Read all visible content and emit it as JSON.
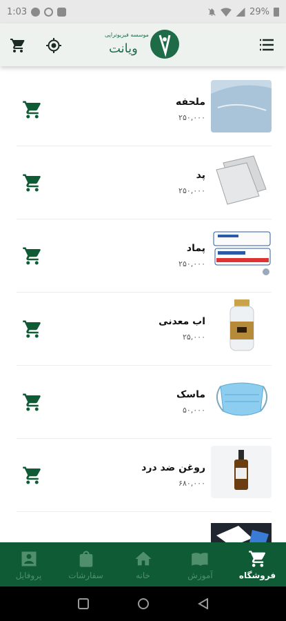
{
  "status": {
    "time": "1:03",
    "battery": "29%"
  },
  "header": {
    "logo_line1": "موسسه فیزیوتراپی",
    "logo_line2": "ویانت"
  },
  "products": [
    {
      "name": "ملحفه",
      "price": "۲۵۰,۰۰۰",
      "img": "sheet"
    },
    {
      "name": "پد",
      "price": "۲۵۰,۰۰۰",
      "img": "pad"
    },
    {
      "name": "پماد",
      "price": "۲۵۰,۰۰۰",
      "img": "ointment"
    },
    {
      "name": "اب معدنی",
      "price": "۲۵,۰۰۰",
      "img": "water"
    },
    {
      "name": "ماسک",
      "price": "۵۰,۰۰۰",
      "img": "mask"
    },
    {
      "name": "روغن ضد درد",
      "price": "۶۸۰,۰۰۰",
      "img": "oil"
    },
    {
      "name": "",
      "price": "",
      "img": "box"
    }
  ],
  "bottom_nav": [
    {
      "label": "فروشگاه",
      "icon": "cart-icon",
      "active": true
    },
    {
      "label": "آموزش",
      "icon": "book-icon",
      "active": false
    },
    {
      "label": "خانه",
      "icon": "home-icon",
      "active": false
    },
    {
      "label": "سفارشات",
      "icon": "bag-icon",
      "active": false
    },
    {
      "label": "پروفایل",
      "icon": "profile-icon",
      "active": false
    }
  ],
  "colors": {
    "primary": "#0f5b36",
    "inactive": "#4f8f6c"
  }
}
